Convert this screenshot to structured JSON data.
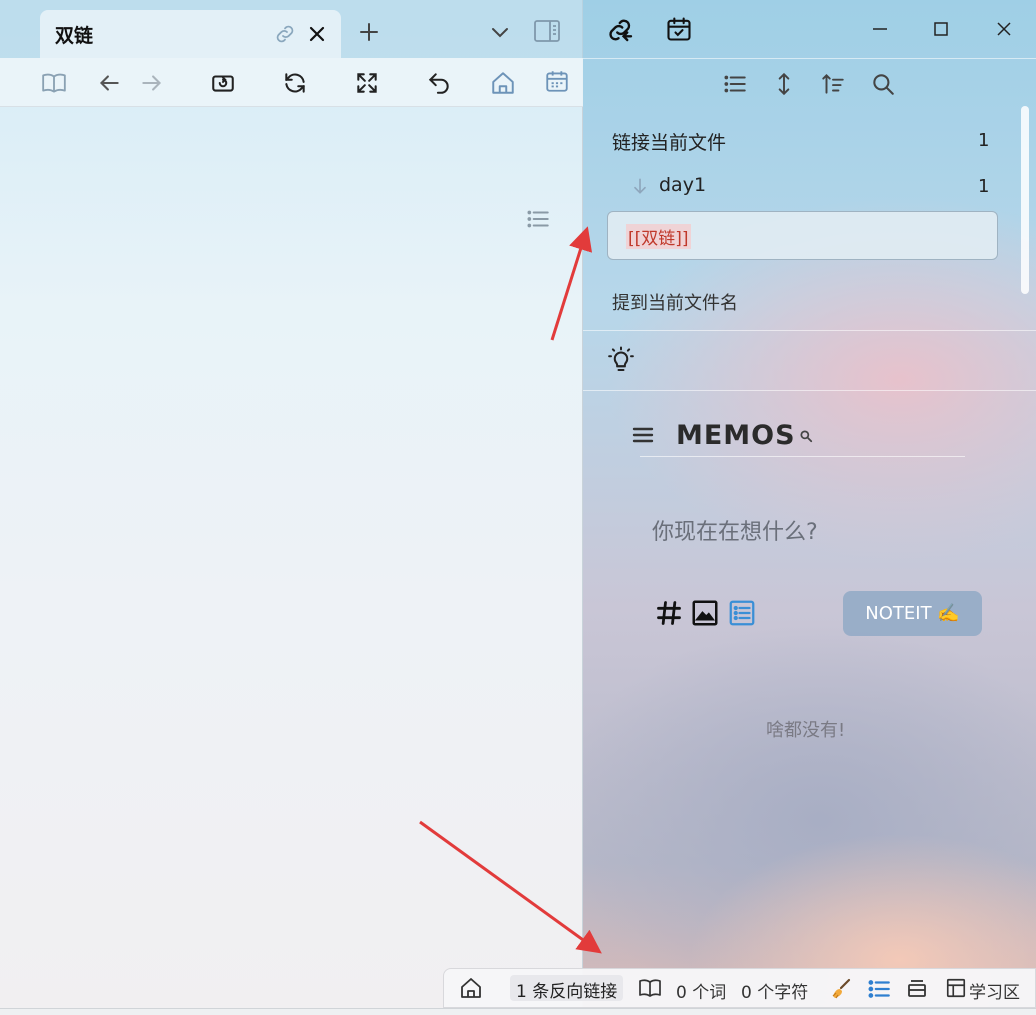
{
  "left": {
    "tab": {
      "title": "双链"
    }
  },
  "backlinks": {
    "linked_section": {
      "label": "链接当前文件",
      "count": "1"
    },
    "file": {
      "name": "day1",
      "count": "1"
    },
    "match_text": "[[双链]]",
    "unlinked_section": {
      "label": "提到当前文件名"
    }
  },
  "memos": {
    "title": "MEMOS",
    "placeholder": "你现在在想什么?",
    "submit_label": "NOTEIT ✍️",
    "empty_text": "啥都没有!"
  },
  "statusbar": {
    "backlinks": "1 条反向链接",
    "words": "0 个词",
    "chars": "0 个字符",
    "layout": "学习区"
  },
  "colors": {
    "accent": "#3a8fd6",
    "match_highlight": "#c0392b",
    "annotation_arrow": "#e23b3b"
  }
}
